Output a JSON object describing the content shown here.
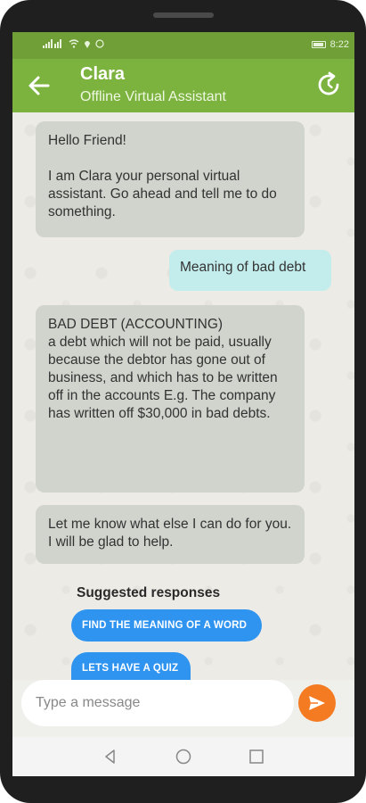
{
  "status_bar": {
    "time": "8:22",
    "icons": [
      "signal-icon",
      "wifi-icon",
      "location-icon",
      "whatsapp-icon",
      "battery-icon"
    ]
  },
  "header": {
    "title": "Clara",
    "subtitle": "Offline Virtual Assistant",
    "back_icon": "back-arrow-icon",
    "refresh_icon": "refresh-icon"
  },
  "messages": [
    {
      "sender": "bot",
      "lines": [
        "Hello Friend!",
        "I am Clara your personal virtual assistant. Go ahead and tell me to do something."
      ]
    },
    {
      "sender": "user",
      "text": "Meaning of bad debt"
    },
    {
      "sender": "bot",
      "text": "BAD DEBT (ACCOUNTING)\na debt which will not be paid, usually because the debtor has gone out of business, and which has to be written off in the accounts  E.g.  The company has written off $30,000 in bad debts."
    },
    {
      "sender": "bot",
      "text": "Let me know what else I can do for you. I will be glad to help."
    }
  ],
  "suggestions": {
    "label": "Suggested responses",
    "chips": [
      "FIND THE MEANING OF A WORD",
      "LETS HAVE A QUIZ"
    ]
  },
  "composer": {
    "placeholder": "Type a message",
    "value": "",
    "send_icon": "send-icon"
  },
  "colors": {
    "app_bar": "#7cb33e",
    "status_bar": "#6f9f36",
    "bot_bubble": "#d1d3cd",
    "user_bubble": "#c3ecec",
    "chip": "#2f93f0",
    "send_button": "#f47b21"
  }
}
